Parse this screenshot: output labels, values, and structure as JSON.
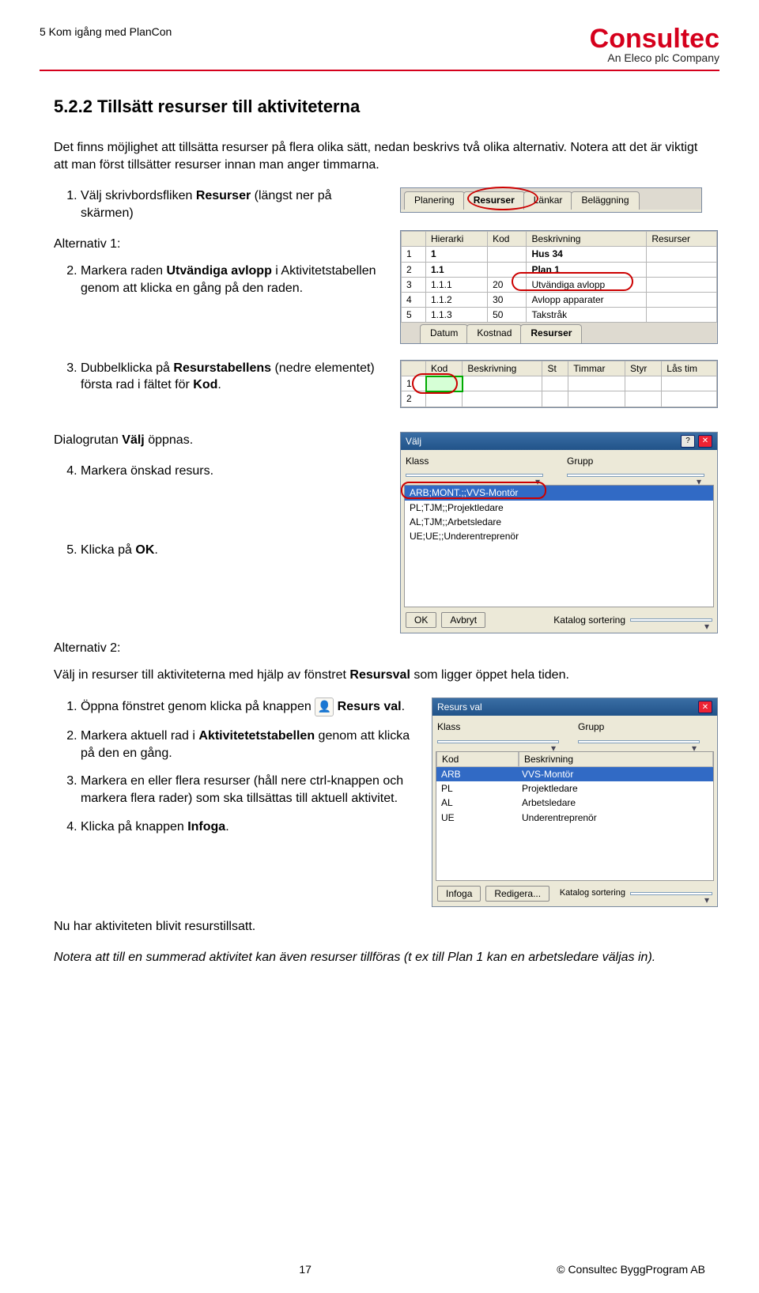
{
  "header_title": "5 Kom igång med PlanCon",
  "logo_main": "Consultec",
  "logo_sub": "An Eleco plc Company",
  "section_h": "5.2.2 Tillsätt resurser till aktiviteterna",
  "intro": "Det finns möjlighet att tillsätta resurser på flera olika sätt, nedan beskrivs två olika alternativ. Notera att det är viktigt att man först tillsätter resurser innan man anger timmarna.",
  "step1_a": "Välj skrivbordsfliken ",
  "step1_b": "Resurser",
  "step1_c": " (längst ner på skärmen)",
  "alt1": "Alternativ 1:",
  "step2_a": "Markera raden ",
  "step2_b": "Utvändiga avlopp",
  "step2_c": " i Aktivitetstabellen genom att klicka en gång på den raden.",
  "step3_a": "Dubbelklicka på ",
  "step3_b": "Resurstabellens",
  "step3_c": " (nedre elementet) första rad i fältet för ",
  "step3_d": "Kod",
  "step3_e": ".",
  "dlg_line_a": "Dialogrutan ",
  "dlg_line_b": "Välj",
  "dlg_line_c": " öppnas.",
  "step4": "Markera önskad resurs.",
  "step5_a": "Klicka på ",
  "step5_b": "OK",
  "step5_c": ".",
  "alt2": "Alternativ 2:",
  "alt2_intro_a": "Välj in resurser till aktiviteterna med hjälp av fönstret ",
  "alt2_intro_b": "Resursval",
  "alt2_intro_c": " som ligger öppet hela tiden.",
  "alt2_s1_a": "Öppna fönstret genom klicka på knappen",
  "alt2_s1_b": "Resurs val",
  "alt2_s1_c": ".",
  "alt2_s2_a": "Markera aktuell rad i ",
  "alt2_s2_b": "Aktivitetetstabellen",
  "alt2_s2_c": " genom att klicka på den en gång.",
  "alt2_s3": "Markera en eller flera resurser (håll nere ctrl-knappen och markera flera rader) som ska tillsättas till aktuell aktivitet.",
  "alt2_s4_a": "Klicka på knappen ",
  "alt2_s4_b": "Infoga",
  "alt2_s4_c": ".",
  "closing": "Nu har aktiviteten blivit resurstillsatt.",
  "note": "Notera att till en summerad aktivitet kan även resurser tillföras (t ex till Plan 1 kan en arbetsledare väljas in).",
  "page_num": "17",
  "copyright": "© Consultec ByggProgram AB",
  "shot_tabs": {
    "t1": "Planering",
    "t2": "Resurser",
    "t3": "Länkar",
    "t4": "Beläggning"
  },
  "shot_act": {
    "h_hier": "Hierarki",
    "h_kod": "Kod",
    "h_besk": "Beskrivning",
    "h_res": "Resurser",
    "r1_n": "1",
    "r1_h": "1",
    "r1_b": "Hus 34",
    "r2_n": "2",
    "r2_h": "1.1",
    "r2_b": "Plan 1",
    "r3_n": "3",
    "r3_h": "1.1.1",
    "r3_k": "20",
    "r3_b": "Utvändiga avlopp",
    "r4_n": "4",
    "r4_h": "1.1.2",
    "r4_k": "30",
    "r4_b": "Avlopp apparater",
    "r5_n": "5",
    "r5_h": "1.1.3",
    "r5_k": "50",
    "r5_b": "Takstråk",
    "tb_datum": "Datum",
    "tb_kost": "Kostnad",
    "tb_res": "Resurser"
  },
  "shot_res": {
    "h_kod": "Kod",
    "h_besk": "Beskrivning",
    "h_st": "St",
    "h_tim": "Timmar",
    "h_styr": "Styr",
    "h_las": "Lås tim",
    "r1": "1",
    "r2": "2"
  },
  "shot_valj": {
    "title": "Välj",
    "lbl_klass": "Klass",
    "lbl_grupp": "Grupp",
    "opt1": "ARB;MONT.;;VVS-Montör",
    "opt2": "PL;TJM;;Projektledare",
    "opt3": "AL;TJM;;Arbetsledare",
    "opt4": "UE;UE;;Underentreprenör",
    "ok": "OK",
    "avbryt": "Avbryt",
    "kat": "Katalog sortering"
  },
  "shot_resval": {
    "title": "Resurs val",
    "lbl_klass": "Klass",
    "lbl_grupp": "Grupp",
    "h_kod": "Kod",
    "h_besk": "Beskrivning",
    "r1k": "ARB",
    "r1b": "VVS-Montör",
    "r2k": "PL",
    "r2b": "Projektledare",
    "r3k": "AL",
    "r3b": "Arbetsledare",
    "r4k": "UE",
    "r4b": "Underentreprenör",
    "infoga": "Infoga",
    "redigera": "Redigera...",
    "kat": "Katalog sortering"
  }
}
